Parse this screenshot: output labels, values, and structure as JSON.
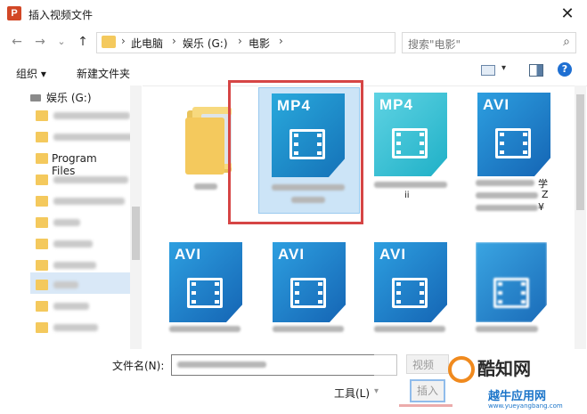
{
  "window": {
    "title": "插入视频文件",
    "app_icon_letter": "P",
    "close_glyph": "✕"
  },
  "nav_buttons": {
    "back": "←",
    "forward": "→",
    "recent": "⌄",
    "up": "↑"
  },
  "address": {
    "crumbs": [
      "此电脑",
      "娱乐 (G:)",
      "电影"
    ],
    "separator": "›",
    "dropdown": "⌄",
    "refresh": "↻"
  },
  "search": {
    "placeholder": "搜索\"电影\"",
    "icon": "⌕"
  },
  "toolbar": {
    "organize": "组织 ▾",
    "new_folder": "新建文件夹",
    "view_caret": "▾",
    "help": "?"
  },
  "sidebar": {
    "drive_label": "娱乐 (G:)",
    "program_files": "Program Files"
  },
  "files": [
    {
      "type": "",
      "kind": "folder"
    },
    {
      "type": "MP4",
      "kind": "video",
      "selected": true
    },
    {
      "type": "MP4",
      "kind": "video"
    },
    {
      "type": "AVI",
      "kind": "video"
    },
    {
      "type": "AVI",
      "kind": "video"
    },
    {
      "type": "AVI",
      "kind": "video"
    },
    {
      "type": "AVI",
      "kind": "video"
    },
    {
      "type": "",
      "kind": "video"
    }
  ],
  "partial_texts": {
    "tile4_suffix1": "学",
    "tile4_suffix2": "Z",
    "tile4_suffix3": "¥",
    "tile3_suffix": "ii"
  },
  "bottom": {
    "filename_label": "文件名(N):",
    "filter_label": "视频",
    "tools_label": "工具(L)",
    "tools_caret": "▾",
    "insert_label": "插入"
  },
  "watermark": {
    "brand": "酷知网",
    "site_name": "越牛应用网",
    "url": "www.yueyangbang.com"
  },
  "colors": {
    "accent": "#0b6ad3",
    "highlight": "#d64545",
    "video_icon": "#1c8fd6",
    "folder": "#f4c95d"
  }
}
